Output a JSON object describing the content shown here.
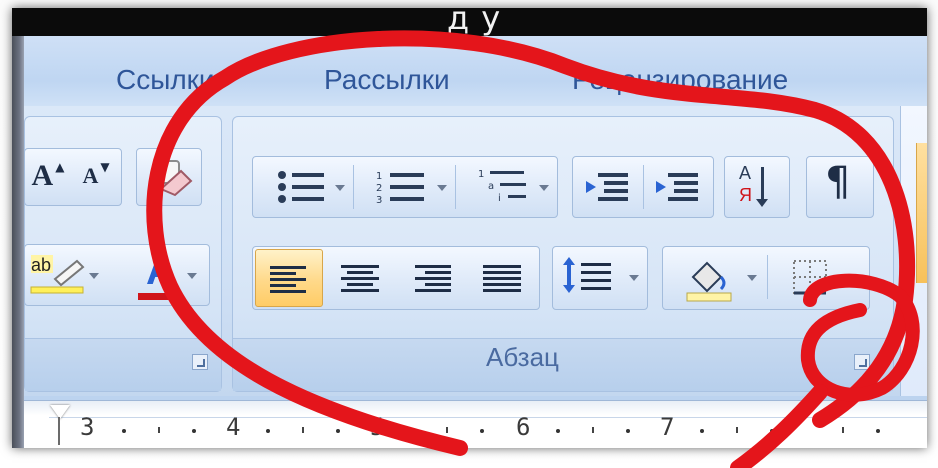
{
  "titlebar": {
    "text": "д у"
  },
  "tabs": [
    {
      "label": "Ссылки"
    },
    {
      "label": "Рассылки"
    },
    {
      "label": "Рецензирование"
    }
  ],
  "groups": {
    "paragraph": {
      "label": "Абзац"
    }
  },
  "icons": {
    "grow_font": "A",
    "shrink_font": "A",
    "font_color": "A",
    "sort": "А Я",
    "show_marks": "¶"
  },
  "colors": {
    "annotation_red": "#e4151b",
    "active_button": "#ffd98a",
    "tab_text": "#2f5699"
  },
  "ruler": {
    "labels": [
      "3",
      "4",
      "5",
      "6",
      "7"
    ]
  }
}
